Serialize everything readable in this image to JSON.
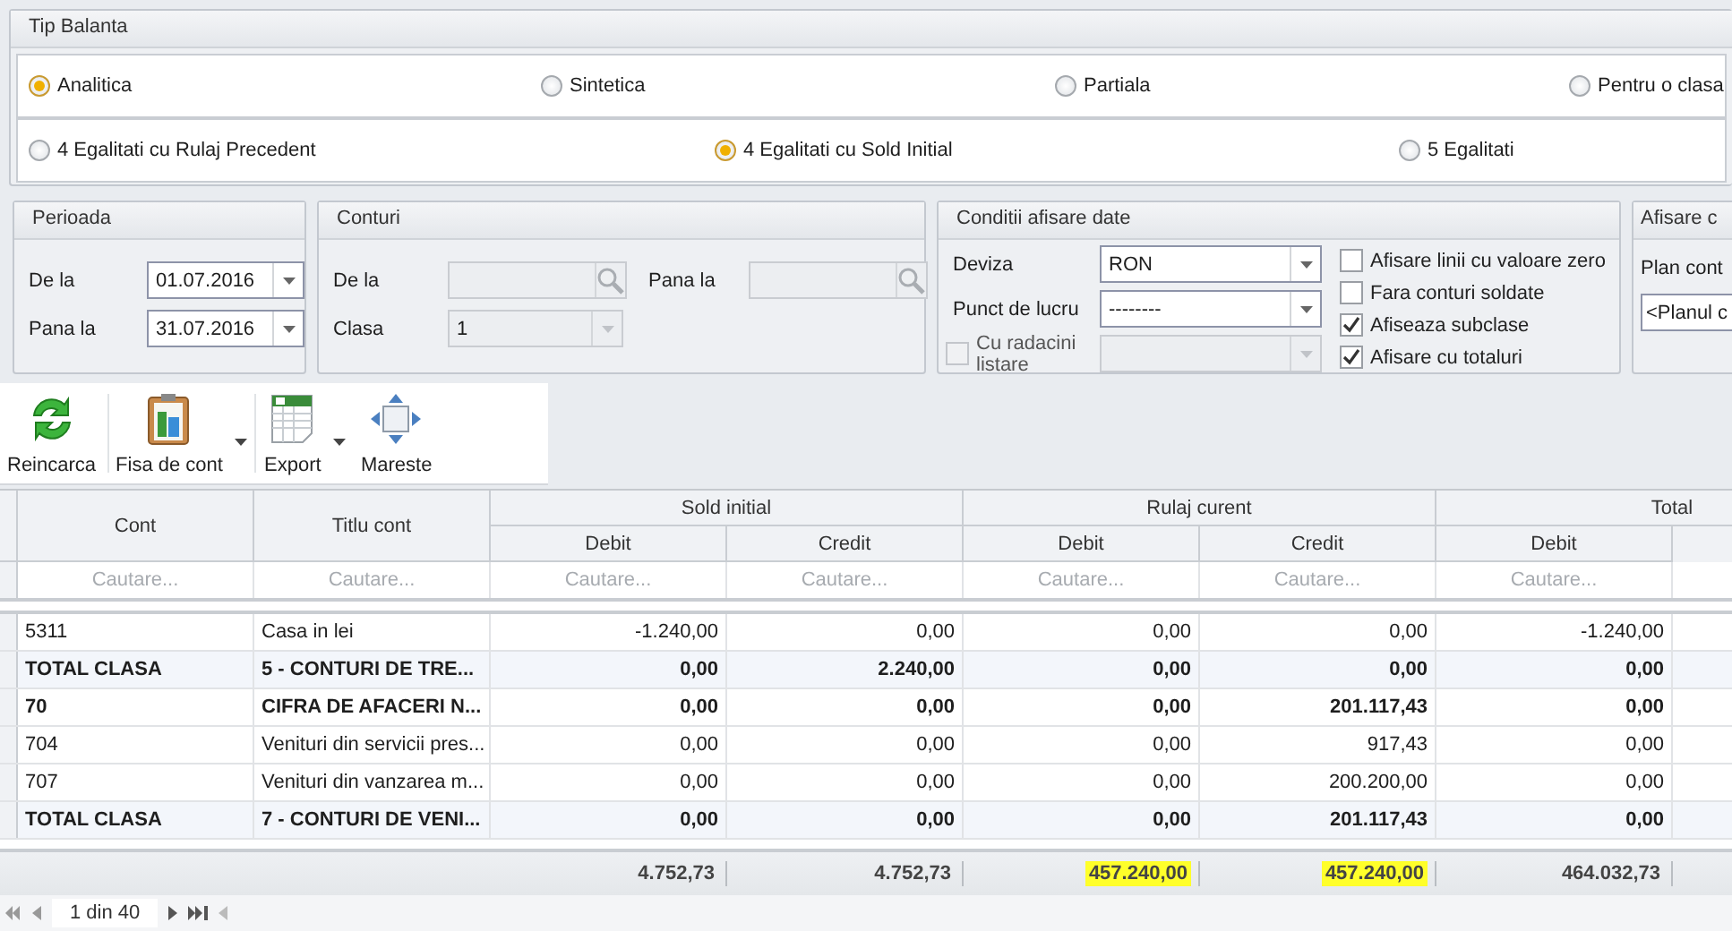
{
  "tip_balanta": {
    "title": "Tip Balanta",
    "row_1": [
      {
        "label": "Analitica",
        "selected": true
      },
      {
        "label": "Sintetica",
        "selected": false
      },
      {
        "label": "Partiala",
        "selected": false
      },
      {
        "label": "Pentru o clasa",
        "selected": false
      }
    ],
    "row_2": [
      {
        "label": "4 Egalitati cu Rulaj Precedent",
        "selected": false
      },
      {
        "label": "4 Egalitati cu Sold Initial",
        "selected": true
      },
      {
        "label": "5 Egalitati",
        "selected": false
      }
    ]
  },
  "perioada": {
    "title": "Perioada",
    "fields": [
      {
        "label": "De la",
        "value": "01.07.2016"
      },
      {
        "label": "Pana la",
        "value": "31.07.2016"
      }
    ]
  },
  "conturi": {
    "title": "Conturi",
    "from_label": "De la",
    "to_label": "Pana la",
    "clasa_label": "Clasa",
    "clasa_value": "1",
    "disabled": true
  },
  "conditii": {
    "title": "Conditii afisare date",
    "deviza_label": "Deviza",
    "deviza_value": "RON",
    "punct_label": "Punct de lucru",
    "punct_value": "--------",
    "radacini": {
      "label": "Cu radacini listare",
      "checked": false,
      "disabled": true
    },
    "options": [
      {
        "label": "Afisare linii cu valoare zero",
        "checked": false
      },
      {
        "label": "Fara conturi soldate",
        "checked": false
      },
      {
        "label": "Afiseaza subclase",
        "checked": true
      },
      {
        "label": "Afisare cu totaluri",
        "checked": true
      }
    ]
  },
  "afisare": {
    "title": "Afisare c",
    "plan_label": "Plan cont",
    "plan_value": "<Planul c"
  },
  "toolbar": [
    {
      "label": "Reincarca",
      "has_menu": false
    },
    {
      "label": "Fisa de cont",
      "has_menu": true
    },
    {
      "label": "Export",
      "has_menu": true
    },
    {
      "label": "Mareste",
      "has_menu": false
    }
  ],
  "table": {
    "columns": [
      "Cont",
      "Titlu cont"
    ],
    "groups": [
      {
        "title": "Sold initial",
        "columns": [
          "Debit",
          "Credit"
        ]
      },
      {
        "title": "Rulaj curent",
        "columns": [
          "Debit",
          "Credit"
        ]
      },
      {
        "title": "Total",
        "columns": [
          "Debit"
        ]
      }
    ],
    "filter_placeholders": [
      "Cautare...",
      "Cautare...",
      "Cautare...",
      "Cautare...",
      "Cautare...",
      "Cautare...",
      "Cautare..."
    ],
    "rows": [
      {
        "kind": "account",
        "cont": "5311",
        "titlu": "Casa in lei",
        "values": [
          "-1.240,00",
          "0,00",
          "0,00",
          "0,00",
          "-1.240,00"
        ]
      },
      {
        "kind": "total",
        "cont": "TOTAL CLASA",
        "titlu": "5 - CONTURI DE TRE...",
        "values": [
          "0,00",
          "2.240,00",
          "0,00",
          "0,00",
          "0,00"
        ]
      },
      {
        "kind": "group",
        "cont": "70",
        "titlu": "CIFRA DE AFACERI N...",
        "values": [
          "0,00",
          "0,00",
          "0,00",
          "201.117,43",
          "0,00"
        ]
      },
      {
        "kind": "account",
        "cont": "704",
        "titlu": "Venituri din servicii pres...",
        "values": [
          "0,00",
          "0,00",
          "0,00",
          "917,43",
          "0,00"
        ]
      },
      {
        "kind": "account",
        "cont": "707",
        "titlu": "Venituri din vanzarea m...",
        "values": [
          "0,00",
          "0,00",
          "0,00",
          "200.200,00",
          "0,00"
        ]
      },
      {
        "kind": "total",
        "cont": "TOTAL CLASA",
        "titlu": "7 - CONTURI DE VENI...",
        "values": [
          "0,00",
          "0,00",
          "0,00",
          "201.117,43",
          "0,00"
        ]
      }
    ],
    "footer": [
      {
        "value": "4.752,73",
        "highlighted": false
      },
      {
        "value": "4.752,73",
        "highlighted": false
      },
      {
        "value": "457.240,00",
        "highlighted": true
      },
      {
        "value": "457.240,00",
        "highlighted": true
      },
      {
        "value": "464.032,73",
        "highlighted": false
      }
    ]
  },
  "pager": {
    "text": "1 din 40"
  }
}
